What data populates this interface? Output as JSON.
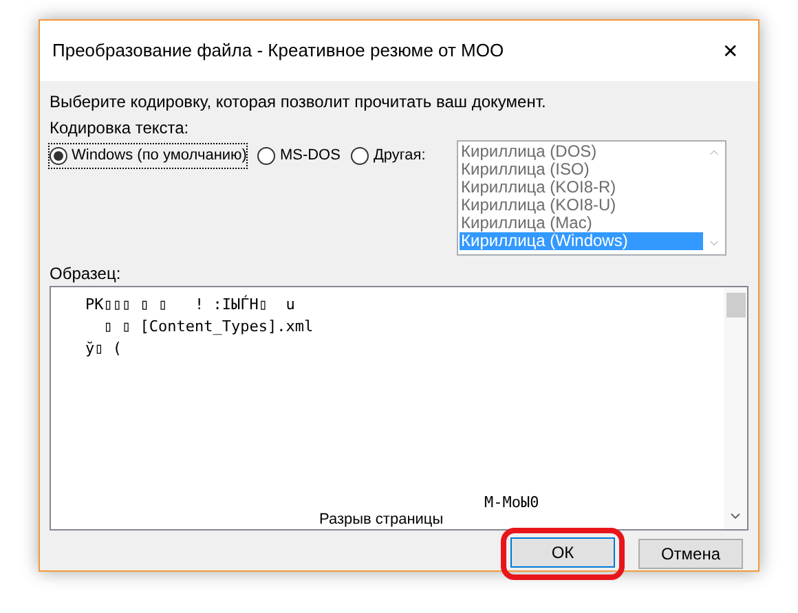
{
  "window": {
    "title": "Преобразование файла - Креативное резюме от МОО",
    "close": "✕"
  },
  "prompt": "Выберите кодировку, которая позволит прочитать ваш документ.",
  "encoding_label": "Кодировка текста:",
  "encoding_options": [
    {
      "label": "Windows (по умолчанию)",
      "selected": true
    },
    {
      "label": "MS-DOS",
      "selected": false
    },
    {
      "label": "Другая:",
      "selected": false
    }
  ],
  "encoding_list": [
    {
      "label": "Кириллица (DOS)",
      "selected": false
    },
    {
      "label": "Кириллица (ISO)",
      "selected": false
    },
    {
      "label": "Кириллица (KOI8-R)",
      "selected": false
    },
    {
      "label": "Кириллица (KOI8-U)",
      "selected": false
    },
    {
      "label": "Кириллица (Mac)",
      "selected": false
    },
    {
      "label": "Кириллица (Windows)",
      "selected": true
    }
  ],
  "sample_label": "Образец:",
  "sample_lines": [
    "PK▯▯▯ ▯ ▯   ! :IЫЃН▯  u",
    "  ▯ ▯ [Content_Types].xml",
    "ў▯ ("
  ],
  "sample_bottom": [
    {
      "kind": "mono",
      "text": "M-MoЫ0"
    },
    {
      "kind": "sans",
      "text": "Разрыв страницы"
    }
  ],
  "buttons": [
    {
      "label": "ОК",
      "highlighted": true
    },
    {
      "label": "Отмена",
      "highlighted": false
    }
  ]
}
